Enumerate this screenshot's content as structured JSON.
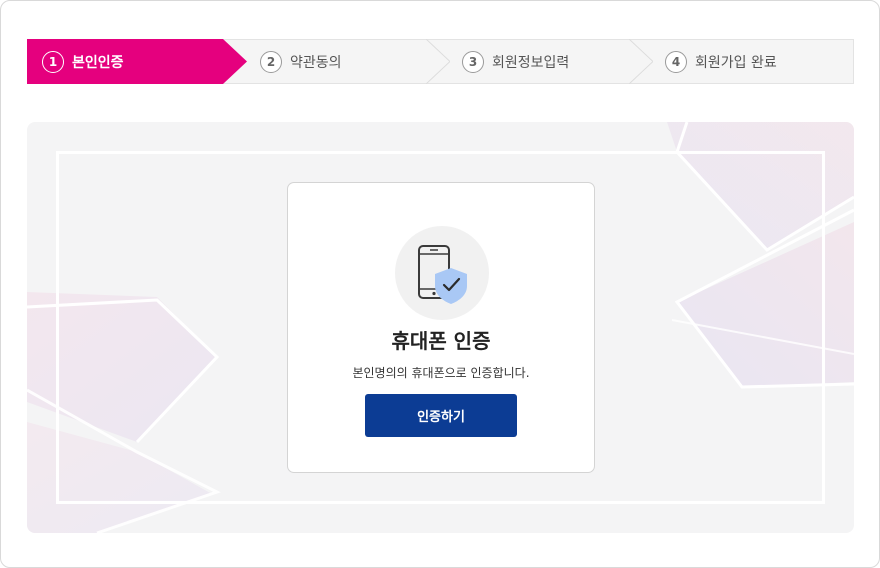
{
  "stepper": {
    "steps": [
      {
        "number": "1",
        "label": "본인인증",
        "active": true
      },
      {
        "number": "2",
        "label": "약관동의",
        "active": false
      },
      {
        "number": "3",
        "label": "회원정보입력",
        "active": false
      },
      {
        "number": "4",
        "label": "회원가입 완료",
        "active": false
      }
    ],
    "active_color": "#e5007e"
  },
  "card": {
    "icon": "phone-shield-check-icon",
    "title": "휴대폰 인증",
    "description": "본인명의의 휴대폰으로 인증합니다.",
    "button_label": "인증하기",
    "button_color": "#0c3c94"
  }
}
